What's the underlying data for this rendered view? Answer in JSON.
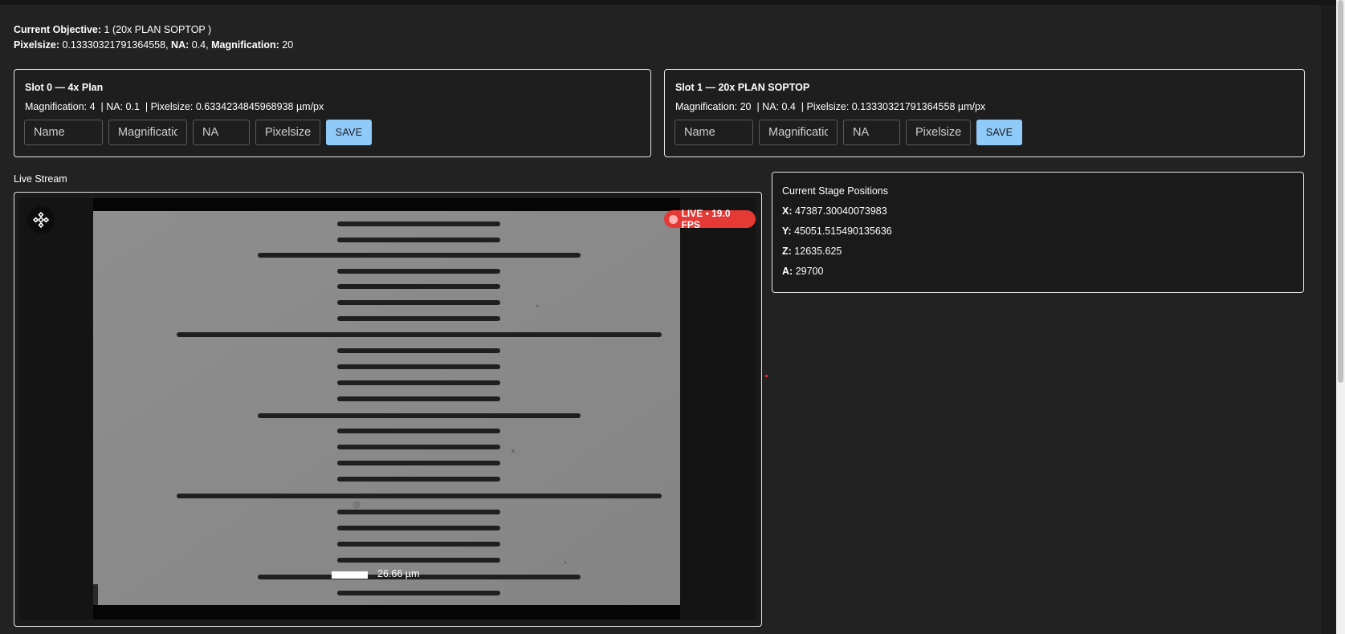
{
  "objective": {
    "current_label": "Current Objective:",
    "current_value": "1 (20x PLAN SOPTOP )",
    "pixelsize_label": "Pixelsize:",
    "pixelsize_value": "0.13330321791364558,",
    "na_label": "NA:",
    "na_value": "0.4,",
    "magnification_label": "Magnification:",
    "magnification_value": "20"
  },
  "slots": [
    {
      "title": "Slot 0 — 4x Plan",
      "details": "Magnification: 4  | NA: 0.1  | Pixelsize: 0.6334234845968938 µm/px",
      "name_placeholder": "Name",
      "magnification_placeholder": "Magnification",
      "na_placeholder": "NA",
      "pixelsize_placeholder": "Pixelsize",
      "save_label": "SAVE"
    },
    {
      "title": "Slot 1 — 20x PLAN SOPTOP",
      "details": "Magnification: 20  | NA: 0.4  | Pixelsize: 0.13330321791364558 µm/px",
      "name_placeholder": "Name",
      "magnification_placeholder": "Magnification",
      "na_placeholder": "NA",
      "pixelsize_placeholder": "Pixelsize",
      "save_label": "SAVE"
    }
  ],
  "live_stream": {
    "label": "Live Stream",
    "badge": "LIVE • 19.0 FPS",
    "scale_bar": "26.66 µm",
    "joystick_icon": "joystick-icon"
  },
  "stage": {
    "title": "Current Stage Positions",
    "x_label": "X:",
    "x_value": "47387.30040073983",
    "y_label": "Y:",
    "y_value": "45051.515490135636",
    "z_label": "Z:",
    "z_value": "12635.625",
    "a_label": "A:",
    "a_value": "29700"
  },
  "colors": {
    "accent": "#90caf9",
    "live": "#e53935",
    "background": "#222222"
  }
}
